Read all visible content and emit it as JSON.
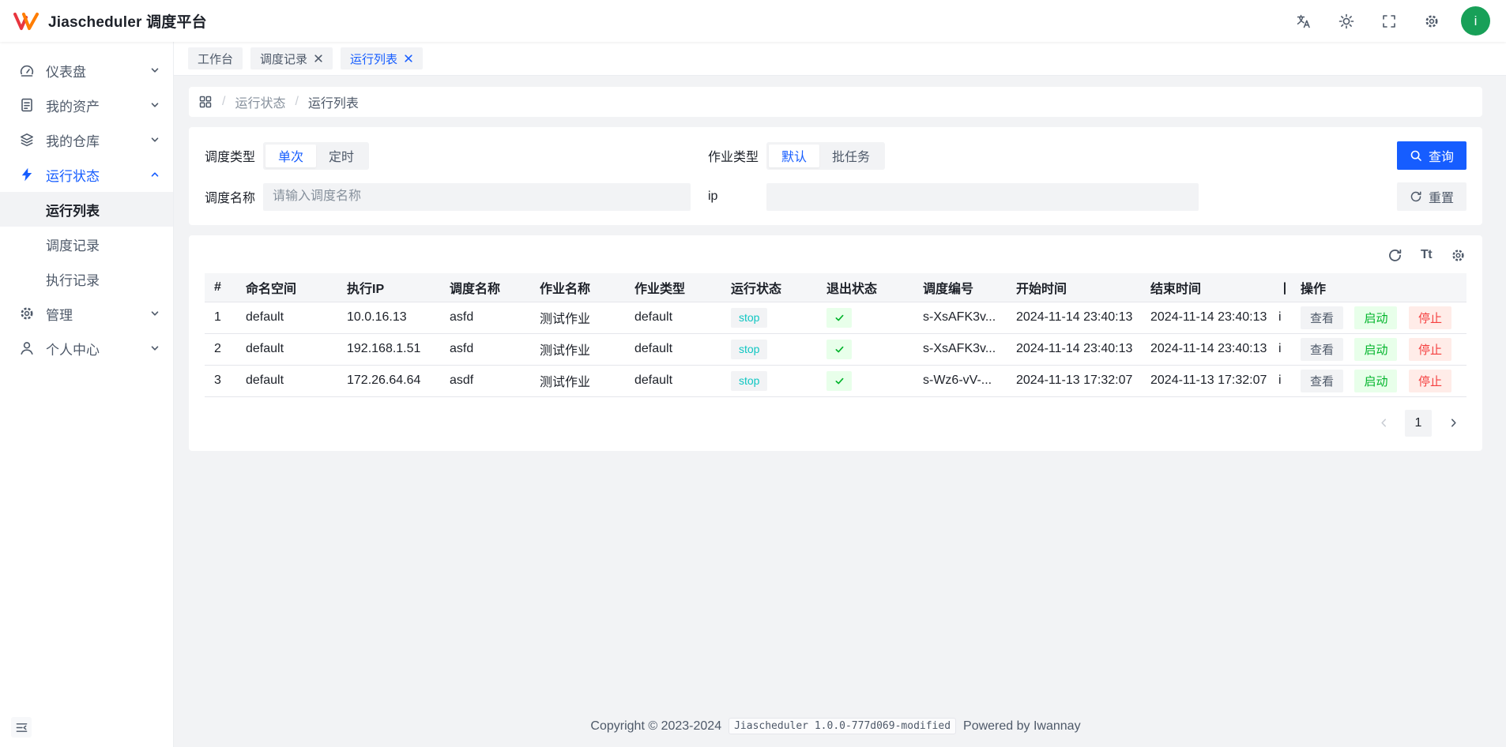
{
  "colors": {
    "primary": "#165dff",
    "page_bg": "#f2f3f5",
    "card_bg": "#ffffff",
    "border": "#e5e6eb",
    "text_primary": "#1d2129",
    "text_secondary": "#4e5969",
    "text_tertiary": "#86909c",
    "success": "#00b42a",
    "success_bg": "#e8ffea",
    "danger": "#f53f3f",
    "danger_bg": "#ffece8",
    "run_status_text": "#0fc6c2",
    "avatar_bg": "#18a058",
    "logo_red": "#e8353e",
    "logo_orange": "#ff7d00"
  },
  "header": {
    "brand": "Jiascheduler 调度平台",
    "avatar": "i"
  },
  "sidebar": {
    "items": [
      {
        "label": "仪表盘"
      },
      {
        "label": "我的资产"
      },
      {
        "label": "我的仓库"
      },
      {
        "label": "运行状态"
      },
      {
        "label": "管理"
      },
      {
        "label": "个人中心"
      }
    ],
    "submenu": [
      {
        "label": "运行列表"
      },
      {
        "label": "调度记录"
      },
      {
        "label": "执行记录"
      }
    ]
  },
  "tabs": [
    {
      "label": "工作台"
    },
    {
      "label": "调度记录"
    },
    {
      "label": "运行列表"
    }
  ],
  "breadcrumb": {
    "separator": "/",
    "items": [
      "运行状态",
      "运行列表"
    ]
  },
  "filters": {
    "schedule_type_label": "调度类型",
    "schedule_type_options": [
      "单次",
      "定时"
    ],
    "job_type_label": "作业类型",
    "job_type_options": [
      "默认",
      "批任务"
    ],
    "schedule_name_label": "调度名称",
    "schedule_name_placeholder": "请输入调度名称",
    "schedule_name_value": "",
    "ip_label": "ip",
    "ip_value": "",
    "search_button": "查询",
    "reset_button": "重置"
  },
  "toolbar": {
    "font_size_icon_text": "Tt"
  },
  "table": {
    "columns": {
      "index": "#",
      "namespace": "命名空间",
      "exec_ip": "执行IP",
      "schedule_name": "调度名称",
      "job_name": "作业名称",
      "job_type": "作业类型",
      "run_status": "运行状态",
      "exit_status": "退出状态",
      "schedule_id": "调度编号",
      "start_time": "开始时间",
      "end_time": "结束时间",
      "clipped": "丨",
      "actions": "操作"
    },
    "rows": [
      {
        "index": "1",
        "namespace": "default",
        "exec_ip": "10.0.16.13",
        "schedule_name": "asfd",
        "job_name": "测试作业",
        "job_type": "default",
        "run_status": "stop",
        "exit_status": "success",
        "schedule_id": "s-XsAFK3v...",
        "start_time": "2024-11-14 23:40:13",
        "end_time": "2024-11-14 23:40:13",
        "clipped": "i"
      },
      {
        "index": "2",
        "namespace": "default",
        "exec_ip": "192.168.1.51",
        "schedule_name": "asfd",
        "job_name": "测试作业",
        "job_type": "default",
        "run_status": "stop",
        "exit_status": "success",
        "schedule_id": "s-XsAFK3v...",
        "start_time": "2024-11-14 23:40:13",
        "end_time": "2024-11-14 23:40:13",
        "clipped": "i"
      },
      {
        "index": "3",
        "namespace": "default",
        "exec_ip": "172.26.64.64",
        "schedule_name": "asdf",
        "job_name": "测试作业",
        "job_type": "default",
        "run_status": "stop",
        "exit_status": "success",
        "schedule_id": "s-Wz6-vV-...",
        "start_time": "2024-11-13 17:32:07",
        "end_time": "2024-11-13 17:32:07",
        "clipped": "i"
      }
    ],
    "actions": {
      "view": "查看",
      "start": "启动",
      "stop": "停止"
    }
  },
  "pagination": {
    "current": "1"
  },
  "footer": {
    "copyright": "Copyright © 2023-2024",
    "version": "Jiascheduler 1.0.0-777d069-modified",
    "powered": "Powered by Iwannay"
  }
}
